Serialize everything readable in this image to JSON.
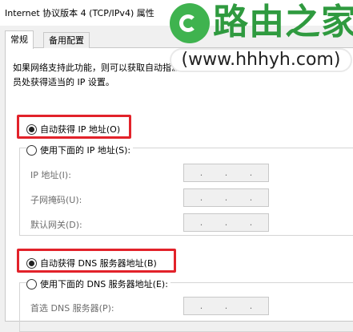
{
  "window": {
    "title": "Internet 协议版本 4 (TCP/IPv4) 属性"
  },
  "tabs": [
    {
      "label": "常规",
      "active": true
    },
    {
      "label": "备用配置",
      "active": false
    }
  ],
  "description": "如果网络支持此功能，则可以获取自动指派的 IP 设置。否则，你需要从网络系统管理员处获得适当的 IP 设置。",
  "ip": {
    "auto_label": "自动获得 IP 地址(O)",
    "auto_selected": true,
    "manual_label": "使用下面的 IP 地址(S):",
    "manual_selected": false,
    "fields": [
      {
        "label": "IP 地址(I):",
        "value": ". . ."
      },
      {
        "label": "子网掩码(U):",
        "value": ". . ."
      },
      {
        "label": "默认网关(D):",
        "value": ". . ."
      }
    ]
  },
  "dns": {
    "auto_label": "自动获得 DNS 服务器地址(B)",
    "auto_selected": true,
    "manual_label": "使用下面的 DNS 服务器地址(E):",
    "manual_selected": false,
    "fields": [
      {
        "label": "首选 DNS 服务器(P):",
        "value": ". . ."
      }
    ]
  },
  "watermark": {
    "title": "路由之家",
    "url": "(www.hhhyh.com)",
    "logo_icon": "e-logo-icon",
    "brand_color": "#2f9a3f"
  },
  "highlight_color": "#e2222a"
}
